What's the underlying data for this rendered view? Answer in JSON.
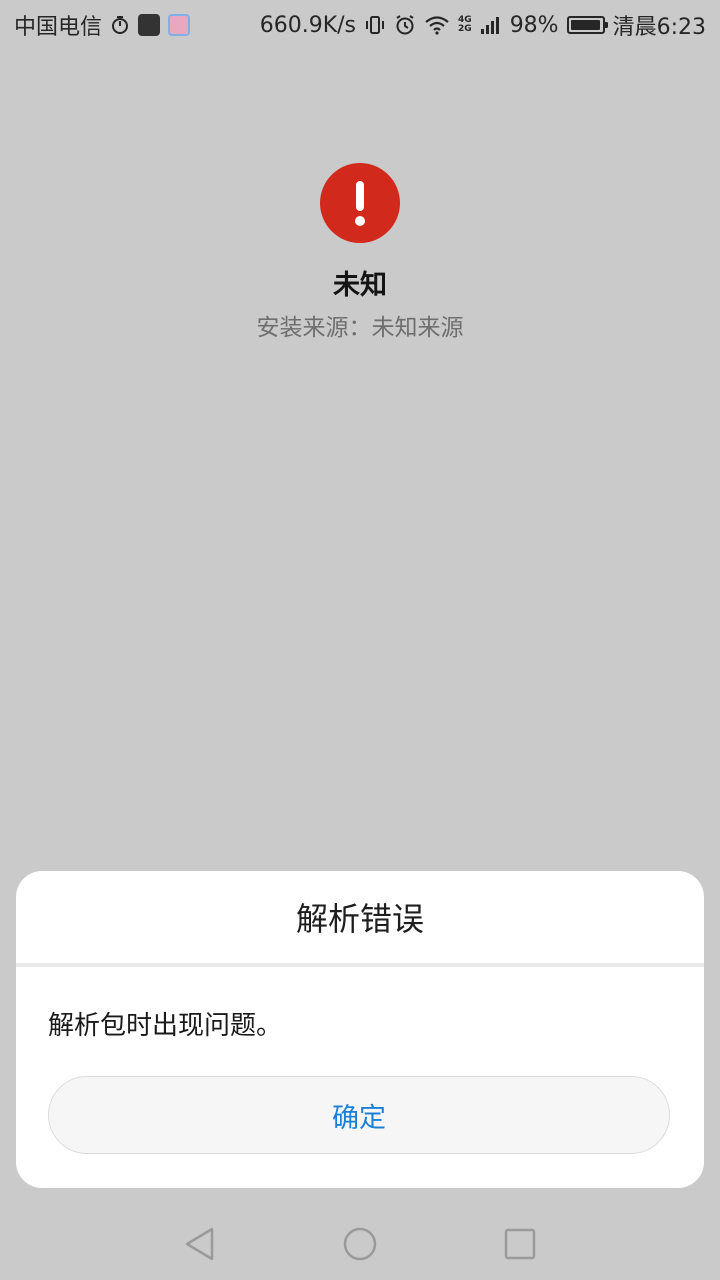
{
  "status_bar": {
    "carrier": "中国电信",
    "net_speed": "660.9K/s",
    "network_type_top": "4G",
    "network_type_bottom": "2G",
    "battery_level": 0.98,
    "battery_text": "98%",
    "time": "清晨6:23",
    "icons": [
      "timer-icon",
      "app-badge-icon",
      "cartoon-app-icon",
      "vibrate-icon",
      "alarm-icon",
      "wifi-icon",
      "signal-icon",
      "battery-icon"
    ]
  },
  "app": {
    "name": "未知",
    "install_source": "安装来源：未知来源",
    "warning_color": "#d1291c"
  },
  "dialog": {
    "title": "解析错误",
    "message": "解析包时出现问题。",
    "confirm_label": "确定",
    "accent_color": "#1d80d8"
  },
  "navigation": {
    "items": [
      "back-icon",
      "home-icon",
      "recents-icon"
    ]
  }
}
